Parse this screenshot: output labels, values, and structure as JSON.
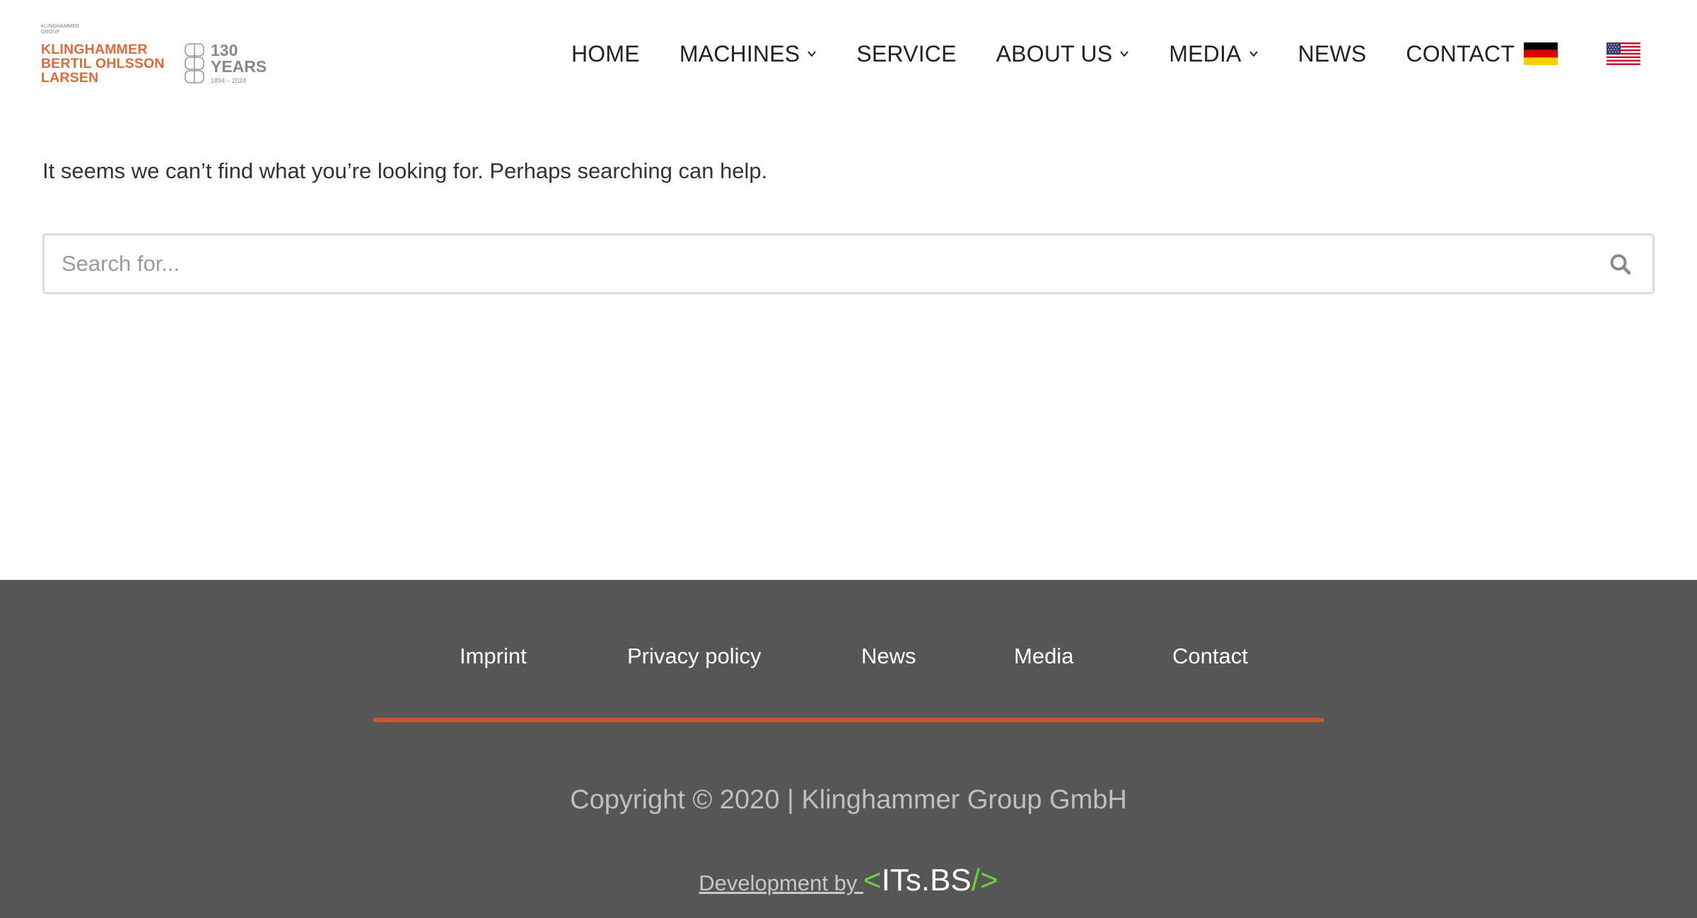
{
  "header": {
    "logo": {
      "group_text": "KLINGHAMMER GROUP",
      "lines": [
        "KLINGHAMMER",
        "BERTIL OHLSSON",
        "LARSEN"
      ],
      "years_number": "130",
      "years_label": "YEARS",
      "years_range": "1894 – 2024"
    },
    "nav": {
      "items": [
        {
          "label": "HOME"
        },
        {
          "label": "MACHINES"
        },
        {
          "label": "SERVICE"
        },
        {
          "label": "ABOUT US"
        },
        {
          "label": "MEDIA"
        },
        {
          "label": "NEWS"
        },
        {
          "label": "CONTACT"
        }
      ]
    },
    "languages": [
      "german-flag-icon",
      "us-flag-icon"
    ]
  },
  "main": {
    "message": "It seems we can’t find what you’re looking for. Perhaps searching can help.",
    "search": {
      "placeholder": "Search for...",
      "value": ""
    }
  },
  "footer": {
    "links": [
      "Imprint",
      "Privacy policy",
      "News",
      "Media",
      "Contact"
    ],
    "copyright": "Copyright © 2020 | Klinghammer Group GmbH",
    "dev_prefix": "Development by ",
    "dev_logo_open": "<",
    "dev_logo_name": "ITs.BS",
    "dev_logo_close": "/>"
  },
  "colors": {
    "brand_orange": "#e0693a",
    "footer_bg": "#565656",
    "footer_rule": "#c9562f",
    "dev_accent": "#6ad23c"
  }
}
